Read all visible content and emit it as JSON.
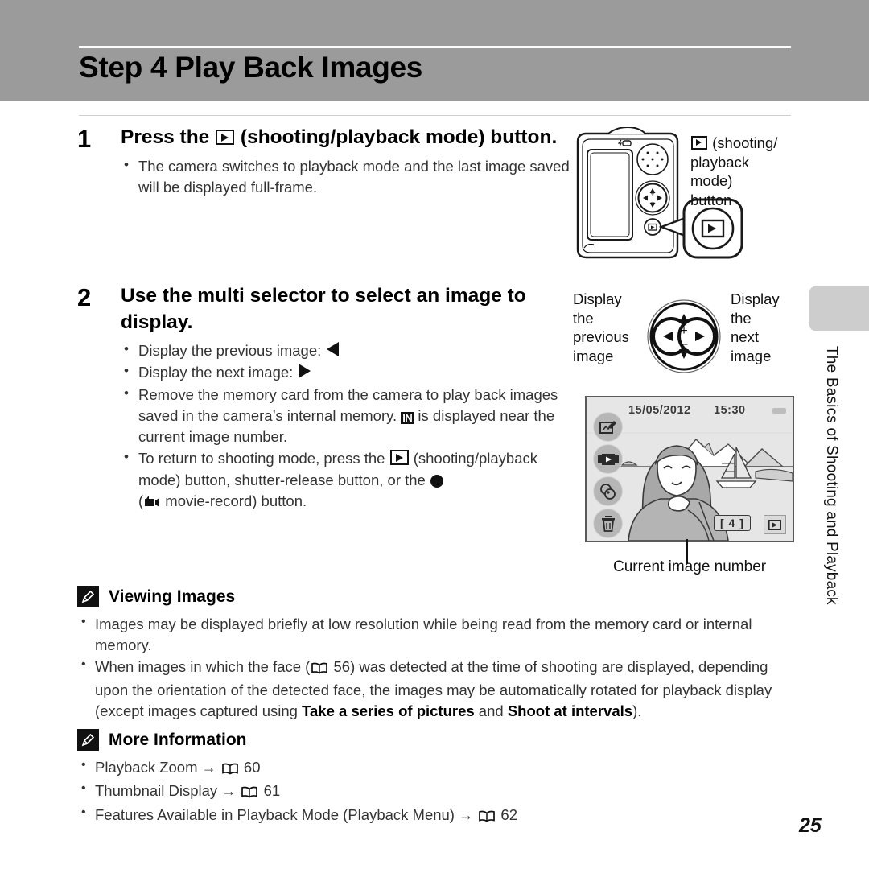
{
  "header": {
    "title": "Step 4 Play Back Images"
  },
  "steps": [
    {
      "number": "1",
      "heading_pre": "Press the ",
      "heading_post": " (shooting/playback mode) button.",
      "bullets": [
        "The camera switches to playback mode and the last image saved will be displayed full-frame."
      ]
    },
    {
      "number": "2",
      "heading": "Use the multi selector to select an image to display.",
      "bullets": [
        "Display the previous image: ",
        "Display the next image: ",
        "Remove the memory card from the camera to play back images saved in the camera’s internal memory. ",
        "To return to shooting mode, press the "
      ]
    }
  ],
  "step2_bullet3": {
    "pre": "Remove the memory card from the camera to play back images saved in the camera’s internal memory. ",
    "in_label": "IN",
    "post": " is displayed near the current image number."
  },
  "step2_bullet4": {
    "pre": "To return to shooting mode, press the ",
    "mid": " (shooting/playback mode) button, shutter-release button, or the ",
    "post": " movie-record) button.",
    "paren_open": "("
  },
  "figures": {
    "camera_callout": {
      "line1": "(shooting/",
      "line2": "playback mode)",
      "line3": "button"
    },
    "multiselector": {
      "left_label": "Display the previous image",
      "left_lines": [
        "Display",
        "the",
        "previous",
        "image"
      ],
      "right_lines": [
        "Display",
        "the",
        "next",
        "image"
      ]
    },
    "lcd": {
      "date": "15/05/2012",
      "time": "15:30",
      "counter": "[    4 ]",
      "caption": "Current image number",
      "icons": [
        "quick-retouch-icon",
        "filmstrip-icon",
        "filter-effects-icon",
        "delete-icon"
      ]
    }
  },
  "notes": [
    {
      "icon": "pencil-note-icon",
      "title": "Viewing Images",
      "bullets": [
        {
          "parts": [
            {
              "type": "text",
              "value": "Images may be displayed briefly at low resolution while being read from the memory card or internal memory."
            }
          ]
        },
        {
          "parts": [
            {
              "type": "text",
              "value": "When images in which the face ("
            },
            {
              "type": "book",
              "value": ""
            },
            {
              "type": "text",
              "value": " 56) was detected at the time of shooting are displayed, depending upon the orientation of the detected face, the images may be automatically rotated for playback display (except images captured using "
            },
            {
              "type": "bold",
              "value": "Take a series of pictures"
            },
            {
              "type": "text",
              "value": " and "
            },
            {
              "type": "bold",
              "value": "Shoot at intervals"
            },
            {
              "type": "text",
              "value": ")."
            }
          ]
        }
      ]
    },
    {
      "icon": "pencil-note-icon",
      "title": "More Information",
      "links": [
        {
          "label": "Playback Zoom",
          "arrow": "→",
          "page": "60"
        },
        {
          "label": "Thumbnail Display",
          "arrow": "→",
          "page": "61"
        },
        {
          "label": "Features Available in Playback Mode (Playback Menu)",
          "arrow": "→",
          "page": "62"
        }
      ]
    }
  ],
  "note_face_pre": "When images in which the face (",
  "note_face_mid": " 56) was detected at the time of shooting are displayed, depending upon the orientation of the detected face, the images may be automatically rotated for playback display (except images captured using ",
  "note_face_bold1": "Take a series of pictures",
  "note_face_and": " and ",
  "note_face_bold2": "Shoot at intervals",
  "note_face_post": ").",
  "sidebar": {
    "text": "The Basics of Shooting and Playback"
  },
  "footer": {
    "page_number": "25"
  },
  "colors": {
    "header_band": "#9b9b9b",
    "side_tab": "#cdcdcd",
    "text": "#333333",
    "heading": "#000000"
  }
}
